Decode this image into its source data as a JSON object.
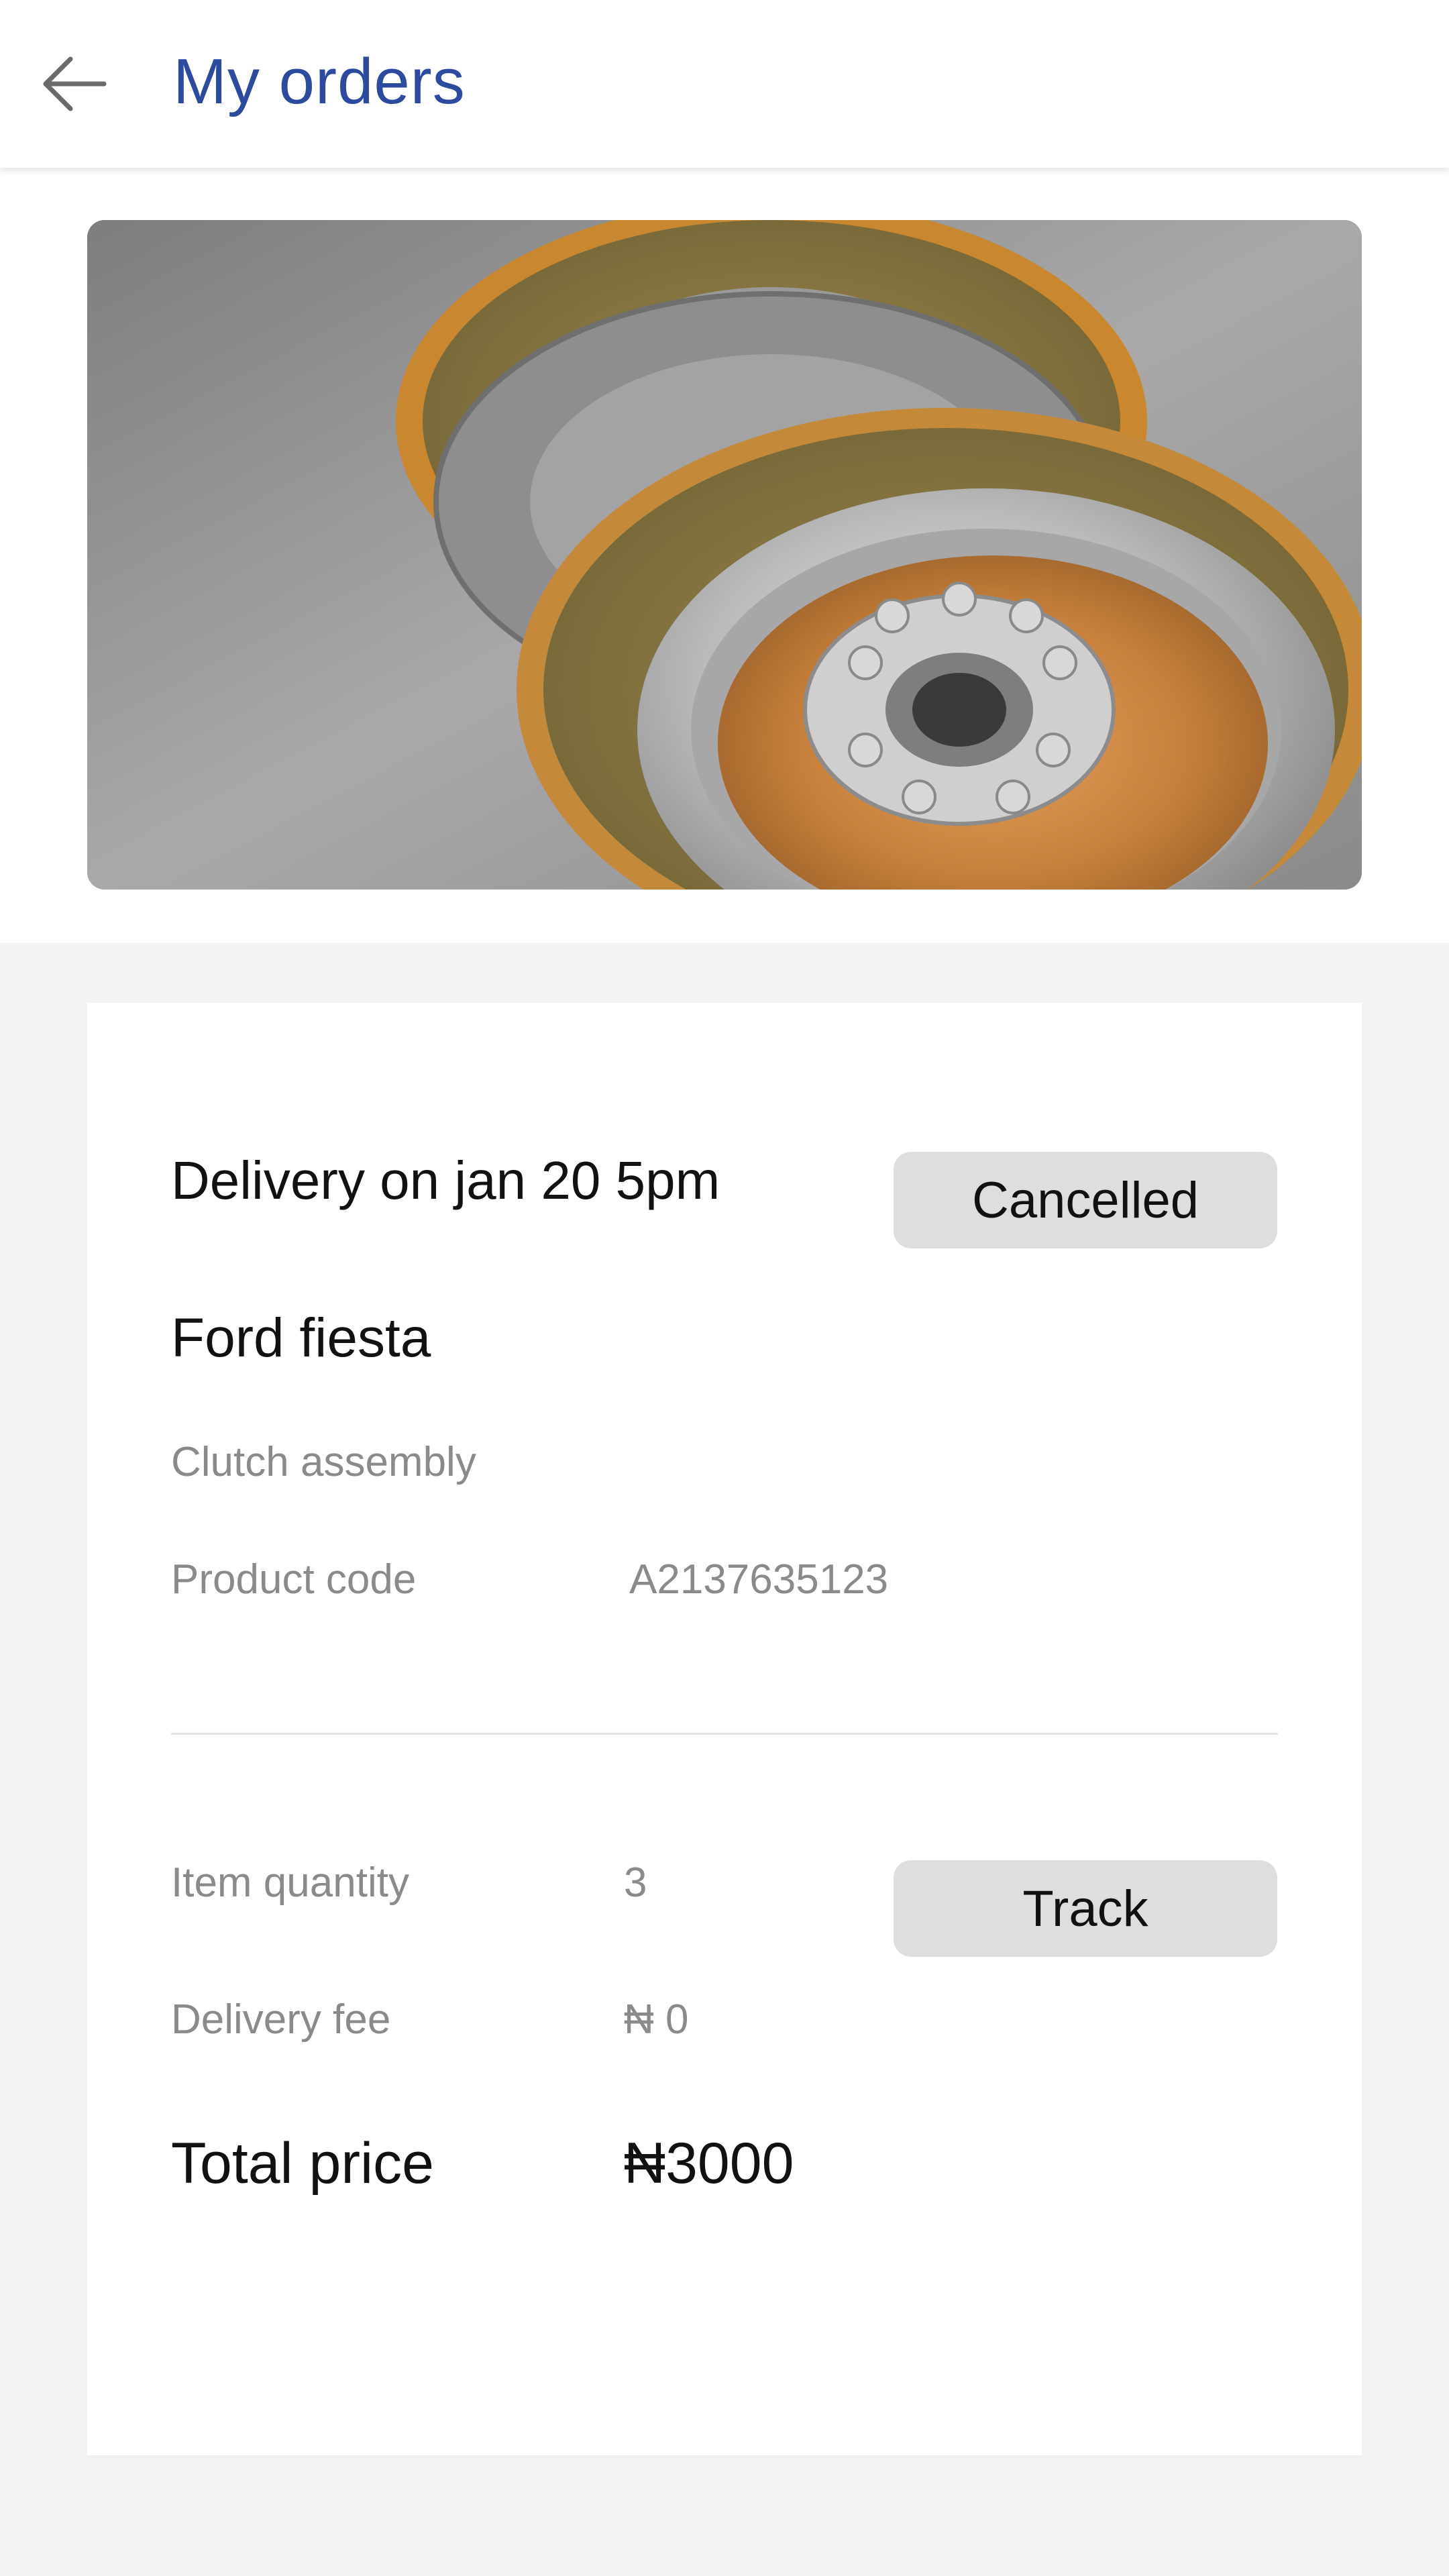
{
  "header": {
    "title": "My orders",
    "back_icon": "arrow-left-icon"
  },
  "product": {
    "image_description": "clutch-assembly-photo"
  },
  "order": {
    "delivery": "Delivery on jan 20  5pm",
    "status": "Cancelled",
    "vehicle": "Ford fiesta",
    "part": "Clutch assembly",
    "product_code_label": "Product code",
    "product_code_value": "A2137635123",
    "quantity_label": "Item quantity",
    "quantity_value": "3",
    "track_label": "Track",
    "delivery_fee_label": "Delivery fee",
    "delivery_fee_value": "₦ 0",
    "total_label": "Total price",
    "total_value": "₦3000"
  },
  "colors": {
    "title": "#2c4a9e",
    "background": "#f3f3f5",
    "badge": "#dedede"
  }
}
